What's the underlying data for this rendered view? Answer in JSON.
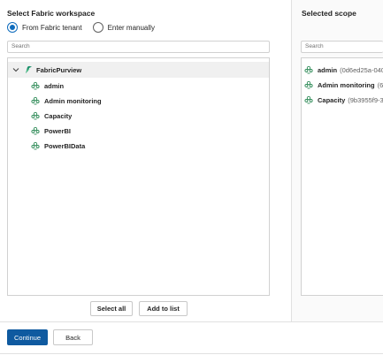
{
  "left": {
    "title": "Select Fabric workspace",
    "radio_from_tenant": "From Fabric tenant",
    "radio_enter_manually": "Enter manually",
    "search_placeholder": "Search",
    "tree": {
      "root_label": "FabricPurview",
      "items": [
        "admin",
        "Admin monitoring",
        "Capacity",
        "PowerBI",
        "PowerBIData"
      ]
    },
    "select_all_label": "Select all",
    "add_to_list_label": "Add to list"
  },
  "right": {
    "title": "Selected scope",
    "search_placeholder": "Search",
    "items": [
      {
        "name": "admin",
        "id": "(0d6ed25a-040"
      },
      {
        "name": "Admin monitoring",
        "id": "(6"
      },
      {
        "name": "Capacity",
        "id": "(9b3955f9-3"
      }
    ]
  },
  "footer": {
    "continue_label": "Continue",
    "back_label": "Back"
  },
  "colors": {
    "primary": "#0f5aa0",
    "radio_selected": "#0f6cbd",
    "workspace_icon": "#2e8b57"
  }
}
